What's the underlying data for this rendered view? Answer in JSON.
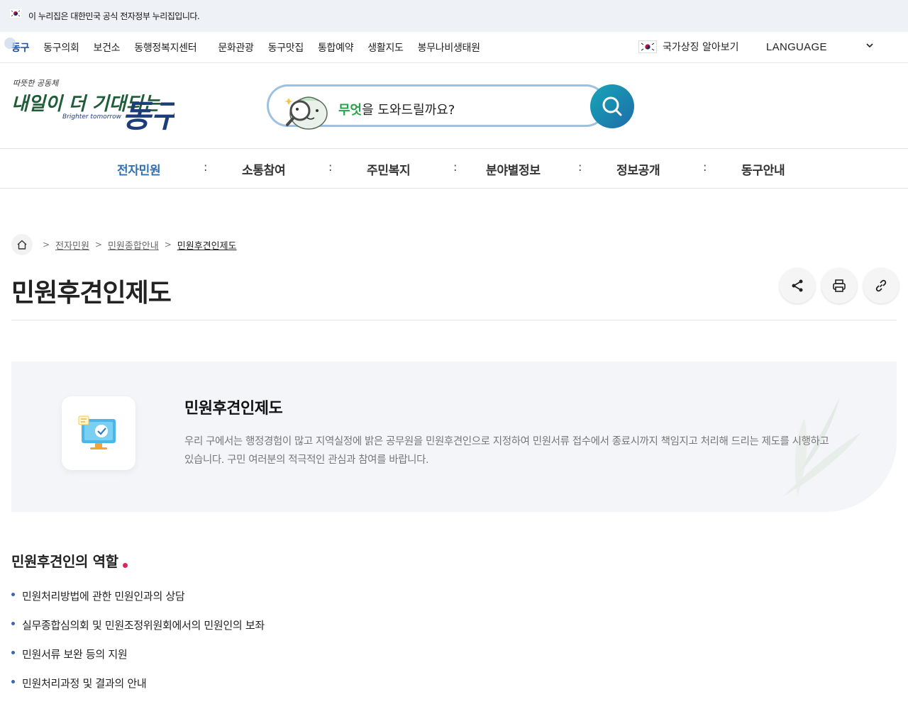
{
  "gov_banner": {
    "text": "이 누리집은 대한민국 공식 전자정부 누리집입니다."
  },
  "util_nav": {
    "links": [
      "동구",
      "동구의회",
      "보건소",
      "동행정복지센터",
      "문화관광",
      "동구맛집",
      "통합예약",
      "생활지도",
      "봉무나비생태원"
    ],
    "national_symbol": "국가상징 알아보기",
    "language": "LANGUAGE"
  },
  "header": {
    "search": {
      "highlight": "무엇",
      "rest": "을 도와드릴까요?"
    }
  },
  "gnb": {
    "items": [
      "전자민원",
      "소통참여",
      "주민복지",
      "분야별정보",
      "정보공개",
      "동구안내"
    ],
    "separator": ":"
  },
  "breadcrumb": {
    "items": [
      "전자민원",
      "민원종합안내",
      "민원후견인제도"
    ]
  },
  "page": {
    "title": "민원후견인제도"
  },
  "intro": {
    "title": "민원후견인제도",
    "description": "우리 구에서는 행정경험이 많고 지역실정에 밝은 공무원을 민원후견인으로 지정하여 민원서류 접수에서 종료시까지 책임지고 처리해 드리는 제도를 시행하고 있습니다. 구민 여러분의 적극적인 관심과 참여를 바랍니다."
  },
  "section": {
    "title": "민원후견인의 역할",
    "roles": [
      "민원처리방법에 관한 민원인과의 상담",
      "실무종합심의회 및 민원조정위원회에서의 민원인의 보좌",
      "민원서류 보완 등의 지원",
      "민원처리과정 및 결과의 안내"
    ]
  },
  "colors": {
    "accent_blue": "#2f6fb2",
    "search_green": "#25a24a",
    "dot_red": "#e0245e"
  }
}
